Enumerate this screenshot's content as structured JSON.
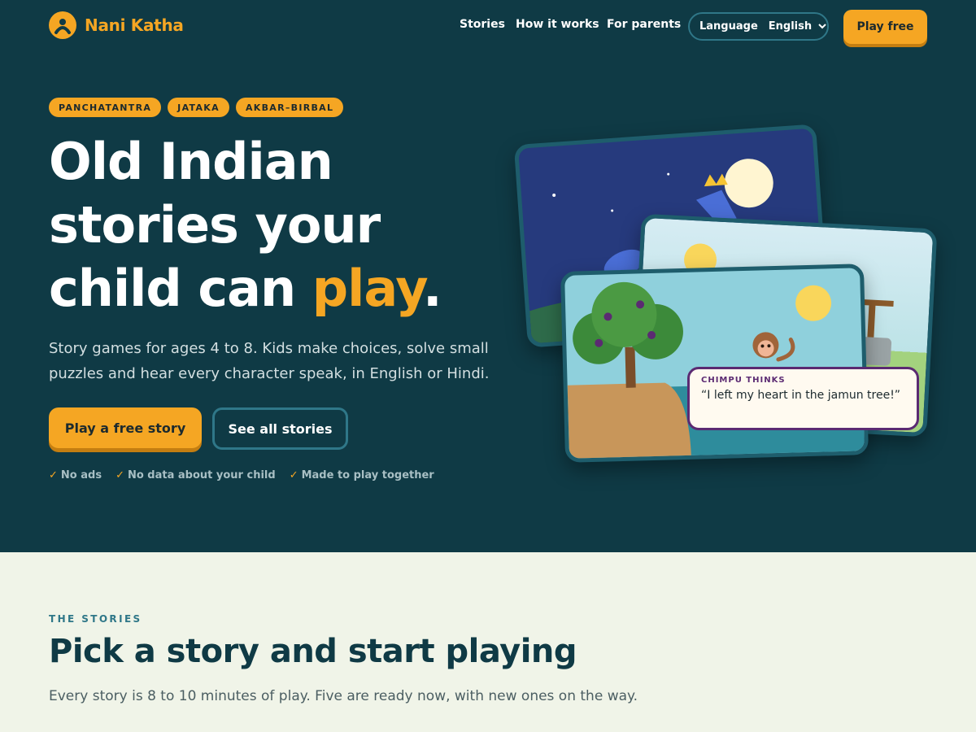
{
  "brand": {
    "name": "Nani Katha",
    "logo_icon": "storyteller-icon"
  },
  "nav": {
    "items": [
      "Stories",
      "How it works",
      "For parents"
    ],
    "language_label": "Language",
    "language_value": "English",
    "cta": "Play free"
  },
  "hero": {
    "tags": [
      "PANCHATANTRA",
      "JATAKA",
      "AKBAR–BIRBAL"
    ],
    "headline_line1": "Old Indian",
    "headline_line2": "stories your",
    "headline_line3_prefix": "child can ",
    "headline_accent": "play",
    "headline_suffix": ".",
    "subcopy": "Story games for ages 4 to 8. Kids make choices, solve small puzzles and hear every character speak, in English or Hindi.",
    "primary_cta": "Play a free story",
    "secondary_cta": "See all stories",
    "perks": [
      "No ads",
      "No data about your child",
      "Made to play together"
    ],
    "bubble_label": "CHIMPU THINKS",
    "bubble_text": "“I left my heart in the jamun tree!”"
  },
  "section": {
    "eyebrow": "THE STORIES",
    "title": "Pick a story and start playing",
    "subtitle": "Every story is 8 to 10 minutes of play. Five are ready now, with new ones on the way."
  },
  "colors": {
    "hero_bg": "#0f3a45",
    "accent": "#f5a623",
    "page_bg": "#f0f4e8",
    "outline": "#2f7788",
    "bubble_border": "#5b2a72"
  }
}
